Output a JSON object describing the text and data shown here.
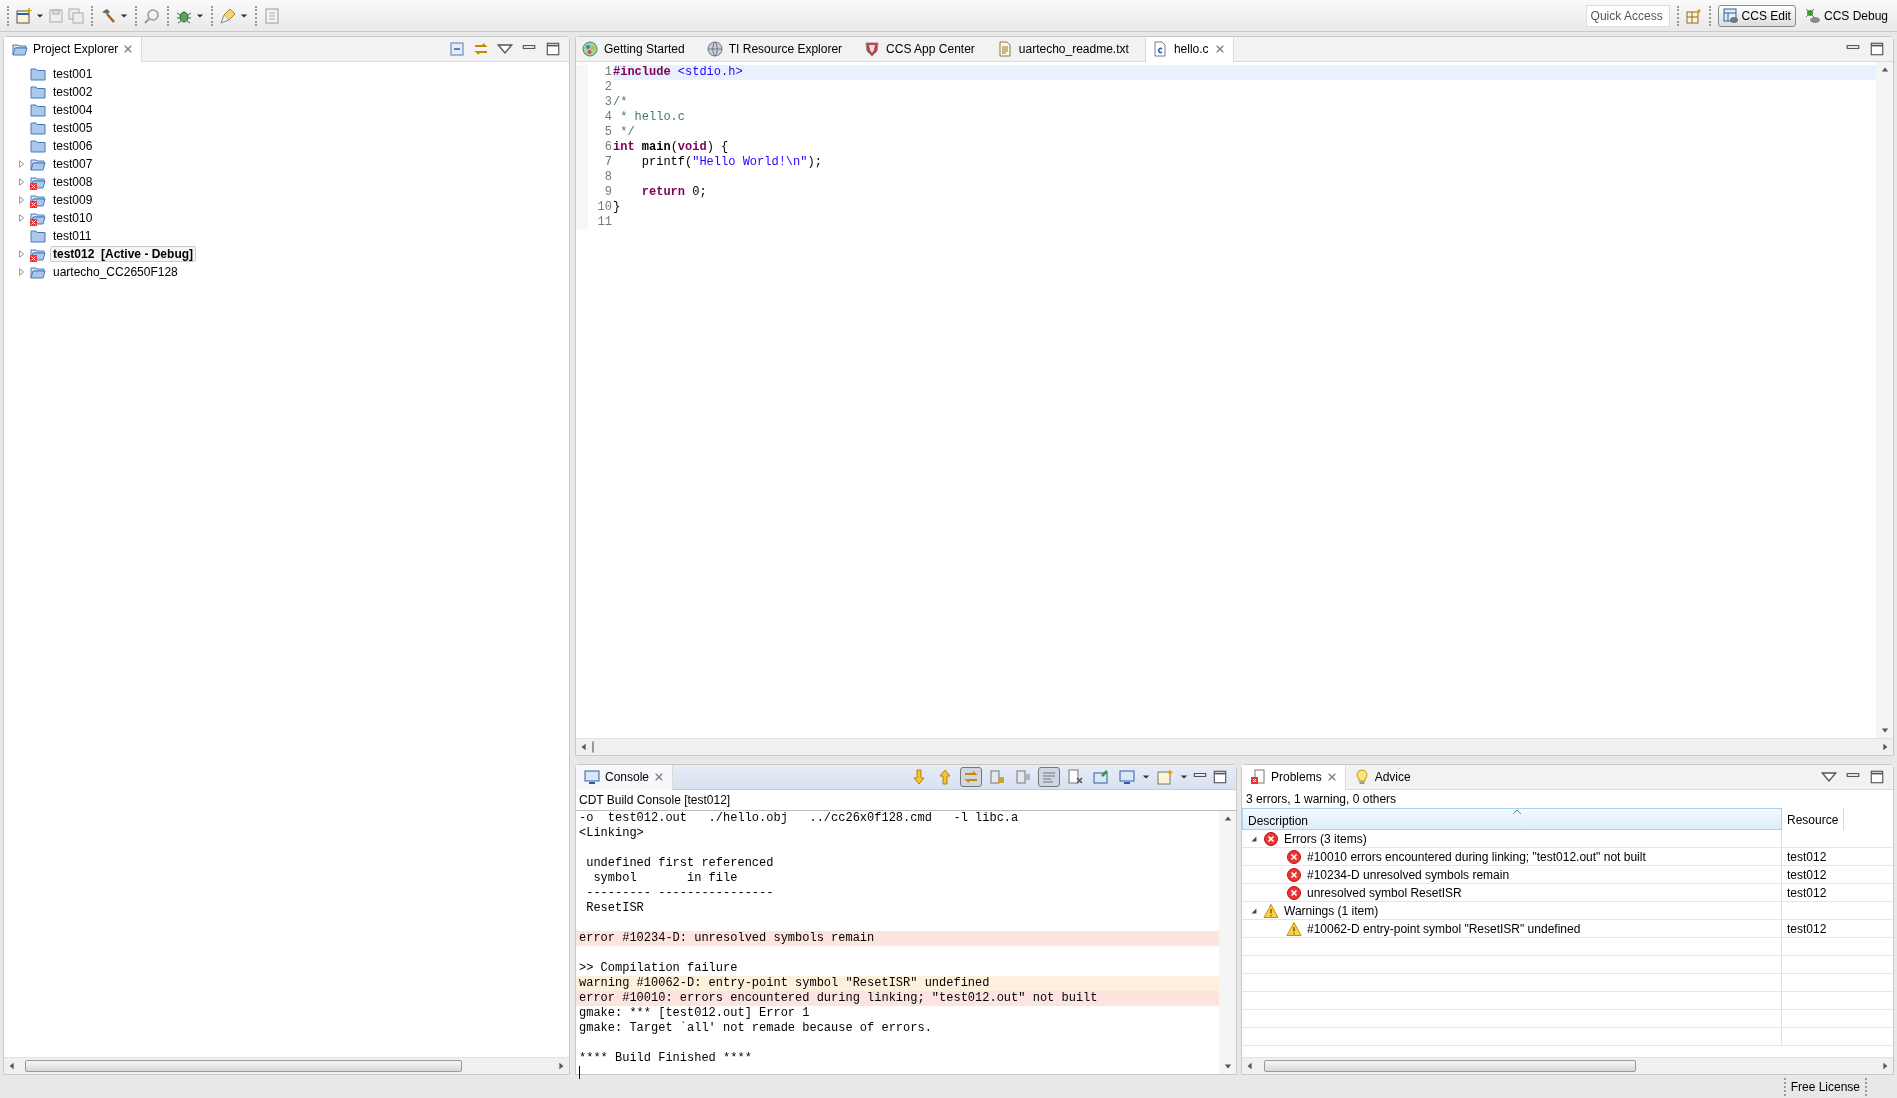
{
  "toolbar": {
    "quick_access": {
      "placeholder": "Quick Access"
    },
    "perspectives": [
      {
        "label": "CCS Edit",
        "kind": "edit",
        "selected": true
      },
      {
        "label": "CCS Debug",
        "kind": "debug",
        "selected": false
      }
    ]
  },
  "project_explorer": {
    "title": "Project Explorer",
    "items": [
      {
        "label": "test001",
        "kind": "folder",
        "expandable": false,
        "active": false
      },
      {
        "label": "test002",
        "kind": "folder",
        "expandable": false,
        "active": false
      },
      {
        "label": "test004",
        "kind": "folder",
        "expandable": false,
        "active": false
      },
      {
        "label": "test005",
        "kind": "folder",
        "expandable": false,
        "active": false
      },
      {
        "label": "test006",
        "kind": "folder",
        "expandable": false,
        "active": false
      },
      {
        "label": "test007",
        "kind": "project",
        "expandable": true,
        "active": false
      },
      {
        "label": "test008",
        "kind": "project-error",
        "expandable": true,
        "active": false
      },
      {
        "label": "test009",
        "kind": "project-error",
        "expandable": true,
        "active": false
      },
      {
        "label": "test010",
        "kind": "project-error",
        "expandable": true,
        "active": false
      },
      {
        "label": "test011",
        "kind": "folder",
        "expandable": false,
        "active": false
      },
      {
        "label": "test012  [Active - Debug]",
        "kind": "project-error",
        "expandable": true,
        "active": true
      },
      {
        "label": "uartecho_CC2650F128",
        "kind": "project",
        "expandable": true,
        "active": false
      }
    ]
  },
  "editor": {
    "tabs": [
      {
        "label": "Getting Started",
        "kind": "start",
        "selected": false
      },
      {
        "label": "TI Resource Explorer",
        "kind": "globe",
        "selected": false
      },
      {
        "label": "CCS App Center",
        "kind": "shield",
        "selected": false
      },
      {
        "label": "uartecho_readme.txt",
        "kind": "text",
        "selected": false
      },
      {
        "label": "hello.c",
        "kind": "c",
        "selected": true
      }
    ],
    "lines": [
      {
        "number": "1",
        "current": true,
        "tokens": [
          {
            "text": "#include ",
            "kind": "keyword"
          },
          {
            "text": "<stdio.h>",
            "kind": "string"
          }
        ]
      },
      {
        "number": "2",
        "current": false
      },
      {
        "number": "3",
        "current": false,
        "tokens": [
          {
            "text": "/*",
            "kind": "comment"
          }
        ]
      },
      {
        "number": "4",
        "current": false,
        "tokens": [
          {
            "text": " * hello.c",
            "kind": "comment"
          }
        ]
      },
      {
        "number": "5",
        "current": false,
        "tokens": [
          {
            "text": " */",
            "kind": "comment"
          }
        ]
      },
      {
        "number": "6",
        "current": false,
        "tokens": [
          {
            "text": "int ",
            "kind": "keyword"
          },
          {
            "text": "main",
            "kind": "function"
          },
          {
            "text": "(",
            "kind": "plain"
          },
          {
            "text": "void",
            "kind": "keyword"
          },
          {
            "text": ") {",
            "kind": "plain"
          }
        ]
      },
      {
        "number": "7",
        "current": false,
        "tokens": [
          {
            "text": "    printf(",
            "kind": "plain"
          },
          {
            "text": "\"Hello World!\\n\"",
            "kind": "string"
          },
          {
            "text": ");",
            "kind": "plain"
          }
        ]
      },
      {
        "number": "8",
        "current": false
      },
      {
        "number": "9",
        "current": false,
        "tokens": [
          {
            "text": "    return",
            "kind": "keyword"
          },
          {
            "text": " 0;",
            "kind": "plain"
          }
        ]
      },
      {
        "number": "10",
        "current": false,
        "tokens": [
          {
            "text": "}",
            "kind": "plain"
          }
        ]
      },
      {
        "number": "11",
        "current": false
      }
    ]
  },
  "console": {
    "title": "Console",
    "subtitle": "CDT Build Console [test012]",
    "tools": [
      {
        "kind": "down",
        "pressed": false
      },
      {
        "kind": "up",
        "pressed": false
      },
      {
        "kind": "link",
        "pressed": true
      },
      {
        "kind": "lock",
        "pressed": false
      },
      {
        "kind": "scroll-lock",
        "pressed": false
      },
      {
        "kind": "wrap",
        "pressed": true
      },
      {
        "kind": "clear",
        "pressed": false
      },
      {
        "kind": "pin",
        "pressed": false
      },
      {
        "kind": "display",
        "pressed": false
      },
      {
        "kind": "new",
        "pressed": false
      }
    ],
    "lines": [
      {
        "text": "-o  test012.out   ./hello.obj   ../cc26x0f128.cmd   -l libc.a",
        "kind": "normal"
      },
      {
        "text": "<Linking>",
        "kind": "normal"
      },
      {
        "kind": "normal"
      },
      {
        "text": " undefined first referenced",
        "kind": "normal"
      },
      {
        "text": "  symbol       in file",
        "kind": "normal"
      },
      {
        "text": " --------- ----------------",
        "kind": "normal"
      },
      {
        "text": " ResetISR",
        "kind": "normal"
      },
      {
        "kind": "normal"
      },
      {
        "text": "error #10234-D: unresolved symbols remain",
        "kind": "error"
      },
      {
        "kind": "normal"
      },
      {
        "text": ">> Compilation failure",
        "kind": "normal"
      },
      {
        "text": "warning #10062-D: entry-point symbol \"ResetISR\" undefined",
        "kind": "warning"
      },
      {
        "text": "error #10010: errors encountered during linking; \"test012.out\" not built",
        "kind": "error"
      },
      {
        "text": "gmake: *** [test012.out] Error 1",
        "kind": "normal"
      },
      {
        "text": "gmake: Target `all' not remade because of errors.",
        "kind": "normal"
      },
      {
        "kind": "normal"
      },
      {
        "text": "**** Build Finished ****",
        "kind": "normal"
      }
    ]
  },
  "problems": {
    "tabs": [
      {
        "label": "Problems",
        "kind": "problems",
        "selected": true
      },
      {
        "label": "Advice",
        "kind": "bulb",
        "selected": false
      }
    ],
    "summary": "3 errors, 1 warning, 0 others",
    "columns": [
      "Description",
      "Resource"
    ],
    "groups": [
      {
        "label": "Errors (3 items)",
        "kind": "error",
        "expanded": true,
        "children": [
          {
            "description": "#10010 errors encountered during linking; \"test012.out\" not built",
            "resource": "test012"
          },
          {
            "description": "#10234-D unresolved symbols remain",
            "resource": "test012"
          },
          {
            "description": "unresolved symbol ResetISR",
            "resource": "test012"
          }
        ]
      },
      {
        "label": "Warnings (1 item)",
        "kind": "warning",
        "expanded": true,
        "children": [
          {
            "description": "#10062-D entry-point symbol \"ResetISR\" undefined",
            "resource": "test012"
          }
        ]
      }
    ]
  },
  "status_bar": {
    "license": "Free License"
  }
}
